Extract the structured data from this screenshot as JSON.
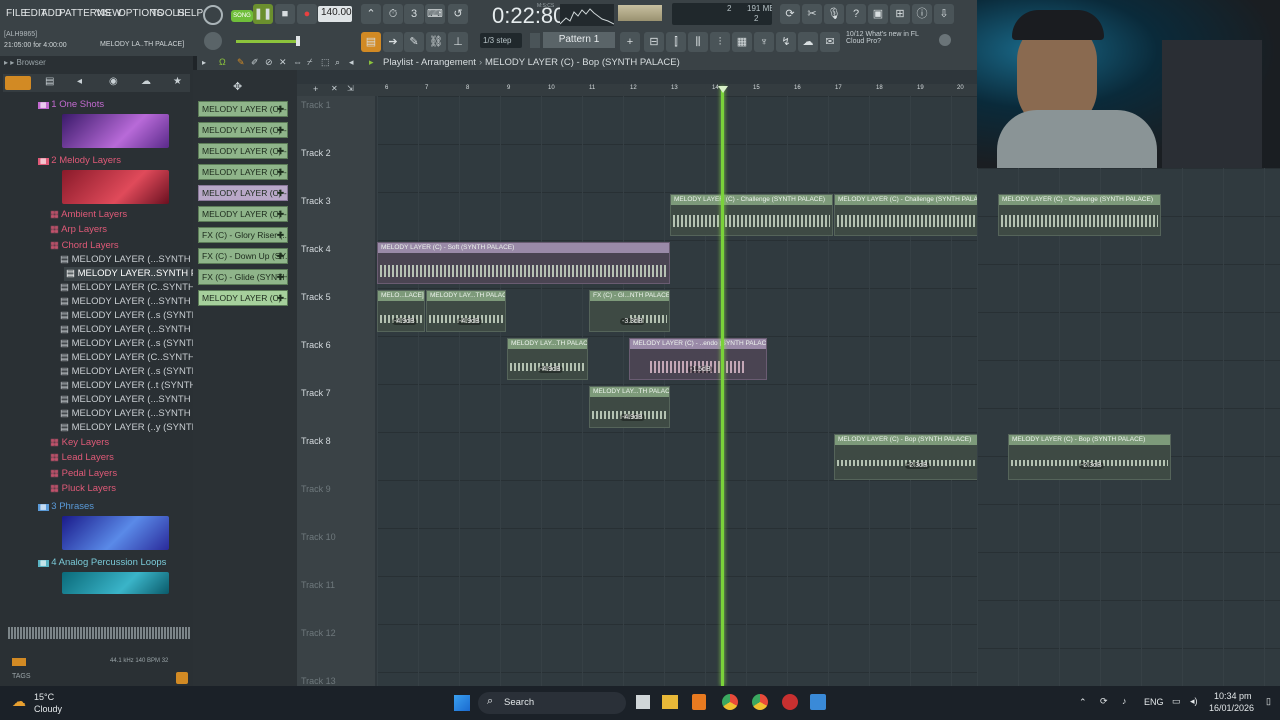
{
  "menu": [
    "FILE",
    "EDIT",
    "ADD",
    "PATTERNS",
    "VIEW",
    "OPTIONS",
    "TOOLS",
    "HELP"
  ],
  "transport": {
    "song_label": "SONG",
    "tempo": "140.000",
    "time": "0:22:80",
    "time_unit": "M:S:CS",
    "cpu": "191 MB",
    "cpu_num": "2",
    "voices": "2"
  },
  "hint": {
    "code": "[ALH9865]",
    "text": "21:05:00 for 4:00:00",
    "song": "MELODY LA..TH PALACE]"
  },
  "snap": "1/3 step",
  "pattern": "Pattern 1",
  "news": {
    "count": "10/12",
    "line1": "What's new in FL",
    "line2": "Cloud Pro?"
  },
  "browser": {
    "title": "Browser",
    "items": [
      {
        "label": "1 One Shots",
        "color": "#c36ad0"
      },
      {
        "label": "2 Melody Layers",
        "color": "#e05a78"
      },
      {
        "label": "Ambient Layers",
        "color": "#e05a78"
      },
      {
        "label": "Arp Layers",
        "color": "#e05a78"
      },
      {
        "label": "Chord Layers",
        "color": "#e05a78"
      },
      {
        "label": "MELODY LAYER (...SYNTH PALACE)",
        "color": "#c9ced2"
      },
      {
        "label": "MELODY LAYER..SYNTH PALACE]",
        "color": "#ffffff"
      },
      {
        "label": "MELODY LAYER (C..SYNTH PALACE)",
        "color": "#c9ced2"
      },
      {
        "label": "MELODY LAYER (...SYNTH PALACE)",
        "color": "#c9ced2"
      },
      {
        "label": "MELODY LAYER (..s (SYNTH PALACE)",
        "color": "#c9ced2"
      },
      {
        "label": "MELODY LAYER (...SYNTH PALACE)",
        "color": "#c9ced2"
      },
      {
        "label": "MELODY LAYER (..s (SYNTH PALACE)",
        "color": "#c9ced2"
      },
      {
        "label": "MELODY LAYER (C..SYNTH PALACE)",
        "color": "#c9ced2"
      },
      {
        "label": "MELODY LAYER (..s (SYNTH PALACE)",
        "color": "#c9ced2"
      },
      {
        "label": "MELODY LAYER (..t (SYNTH PALACE)",
        "color": "#c9ced2"
      },
      {
        "label": "MELODY LAYER (...SYNTH PALACE)",
        "color": "#c9ced2"
      },
      {
        "label": "MELODY LAYER (...SYNTH PALACE)",
        "color": "#c9ced2"
      },
      {
        "label": "MELODY LAYER (..y (SYNTH PALACE)",
        "color": "#c9ced2"
      },
      {
        "label": "Key Layers",
        "color": "#e05a78"
      },
      {
        "label": "Lead Layers",
        "color": "#e05a78"
      },
      {
        "label": "Pedal Layers",
        "color": "#e05a78"
      },
      {
        "label": "Pluck Layers",
        "color": "#e05a78"
      },
      {
        "label": "3 Phrases",
        "color": "#5a9ad8"
      },
      {
        "label": "4 Analog Percussion Loops",
        "color": "#5ab4c4"
      }
    ],
    "footer": "44.1 kHz 140 BPM 32",
    "tags": "TAGS"
  },
  "picker": [
    "MELODY LAYER (C) - C..",
    "MELODY LAYER (C) - C..",
    "MELODY LAYER (C) - S..",
    "MELODY LAYER (C) - C..",
    "MELODY LAYER (C) - C..",
    "MELODY LAYER (C) - C..",
    "FX (C) - Glory Riser (...",
    "FX (C) - Down Up (SY...",
    "FX (C) - Glide (SYNTH...",
    "MELODY LAYER (C) - C.."
  ],
  "playlist": {
    "title": "Playlist - Arrangement",
    "current": "MELODY LAYER (C) - Bop (SYNTH PALACE)",
    "bars": [
      "6",
      "7",
      "8",
      "9",
      "10",
      "11",
      "12",
      "13",
      "14",
      "15",
      "16",
      "17",
      "18",
      "19",
      "20"
    ],
    "tracks": [
      "Track 1",
      "Track 2",
      "Track 3",
      "Track 4",
      "Track 5",
      "Track 6",
      "Track 7",
      "Track 8",
      "Track 9",
      "Track 10",
      "Track 11",
      "Track 12",
      "Track 13"
    ],
    "clips": {
      "t3a": "MELODY LAYER (C) - Challenge (SYNTH PALACE)",
      "t3b": "MELODY LAYER (C) - Challenge (SYNTH PALACE)",
      "t3c": "MELODY LAYER (C) - Challenge (SYNTH PALACE)",
      "t4": "MELODY LAYER (C) - Soft (SYNTH PALACE)",
      "t5a": "MELO...LACE]",
      "t5b": "MELODY LAY...TH PALACE]",
      "t5c": "FX (C) - Gl...NTH PALACE]",
      "t6a": "MELODY LAY...TH PALACE]",
      "t6b": "MELODY LAYER (C) - ..endo (SYNTH PALACE)",
      "t7": "MELODY LAY...TH PALACE]",
      "t8a": "MELODY LAYER (C) - Bop (SYNTH PALACE)",
      "t8b": "MELODY LAYER (C) - Bop (SYNTH PALACE)"
    },
    "db": {
      "t5a": "-4.9dB",
      "t5b": "-4.9dB",
      "t5c": "-3.3dB",
      "t6a": "-4.9dB",
      "t6b": "-1.5dB",
      "t7": "-4.9dB",
      "t8a": "-2.3dB",
      "t8b": "-2.3dB"
    }
  },
  "taskbar": {
    "temp": "15°C",
    "weather": "Cloudy",
    "search": "Search",
    "lang": "ENG",
    "time": "10:34 pm",
    "date": "16/01/2026"
  }
}
